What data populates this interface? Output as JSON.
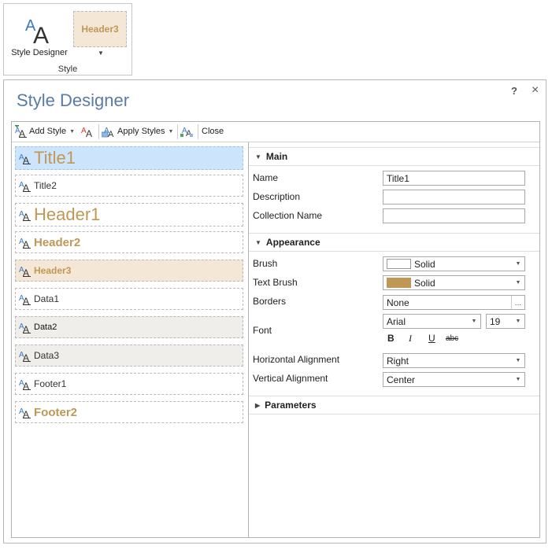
{
  "ribbon": {
    "style_designer_label": "Style Designer",
    "gallery_item": "Header3",
    "group_label": "Style"
  },
  "dialog": {
    "title": "Style Designer",
    "help": "?",
    "close": "×"
  },
  "toolbar": {
    "add_style": "Add Style",
    "apply_styles": "Apply Styles",
    "close": "Close"
  },
  "styles": [
    {
      "name": "Title1"
    },
    {
      "name": "Title2"
    },
    {
      "name": "Header1"
    },
    {
      "name": "Header2"
    },
    {
      "name": "Header3"
    },
    {
      "name": "Data1"
    },
    {
      "name": "Data2"
    },
    {
      "name": "Data3"
    },
    {
      "name": "Footer1"
    },
    {
      "name": "Footer2"
    }
  ],
  "props": {
    "main": {
      "label": "Main",
      "name_label": "Name",
      "name_value": "Title1",
      "description_label": "Description",
      "description_value": "",
      "collection_label": "Collection Name",
      "collection_value": ""
    },
    "appearance": {
      "label": "Appearance",
      "brush_label": "Brush",
      "brush_value": "Solid",
      "text_brush_label": "Text Brush",
      "text_brush_value": "Solid",
      "borders_label": "Borders",
      "borders_value": "None",
      "font_label": "Font",
      "font_family": "Arial",
      "font_size": "19",
      "bold": "B",
      "italic": "I",
      "underline": "U",
      "strike": "abc",
      "halign_label": "Horizontal Alignment",
      "halign_value": "Right",
      "valign_label": "Vertical Alignment",
      "valign_value": "Center"
    },
    "parameters": {
      "label": "Parameters"
    }
  },
  "colors": {
    "accent_tan": "#c09856",
    "title_blue": "#5a7aa8",
    "selection": "#cde5fc",
    "text_brush_swatch": "#c09856",
    "brush_swatch": "#ffffff"
  },
  "icons": [
    "style-designer-icon",
    "add-style-icon",
    "format-icon",
    "apply-styles-icon",
    "grid-icon",
    "aa-style-icon"
  ]
}
